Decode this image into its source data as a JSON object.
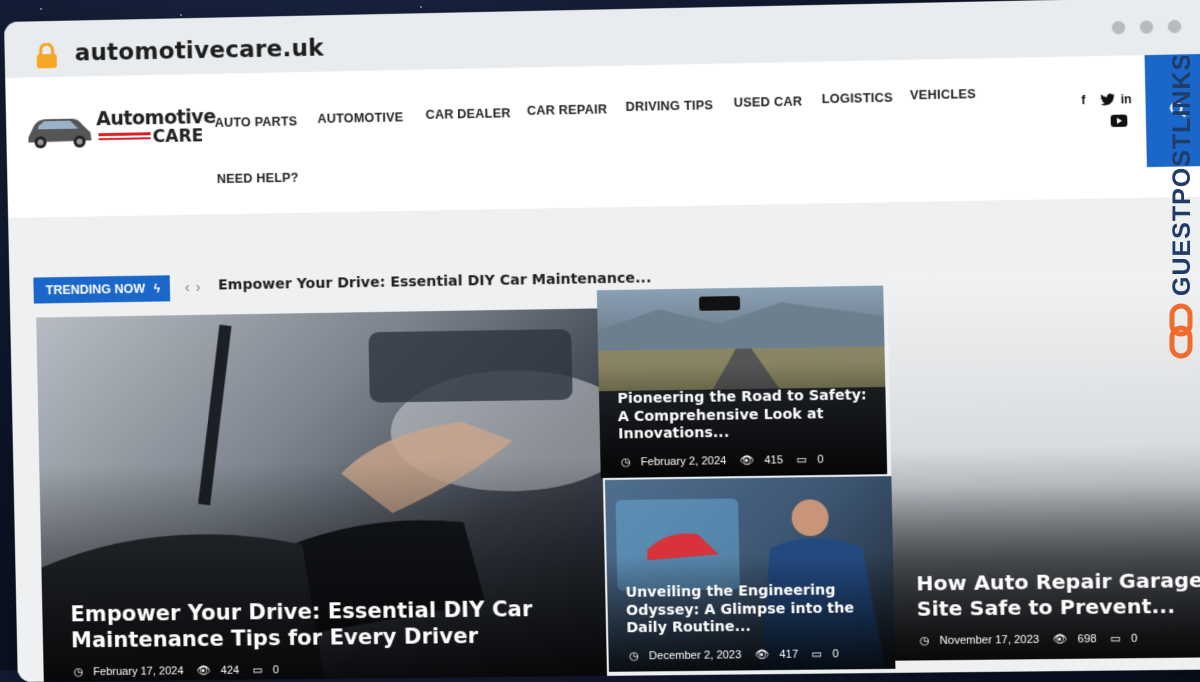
{
  "browser": {
    "url": "automotivecare.uk"
  },
  "logo": {
    "line1": "Automotive",
    "line2": "CARE"
  },
  "nav": {
    "items": [
      "AUTO PARTS",
      "AUTOMOTIVE",
      "CAR DEALER",
      "CAR REPAIR",
      "DRIVING TIPS",
      "USED CAR",
      "LOGISTICS",
      "VEHICLES",
      "NEED HELP?"
    ]
  },
  "social": {
    "facebook": "f",
    "twitter": "t",
    "linkedin": "in",
    "youtube": "yt"
  },
  "trending": {
    "label": "TRENDING NOW",
    "headline": "Empower Your Drive: Essential DIY Car Maintenance..."
  },
  "posts": [
    {
      "title": "Empower Your Drive: Essential DIY Car Maintenance Tips for Every Driver",
      "date": "February 17, 2024",
      "views": "424",
      "comments": "0"
    },
    {
      "title": "Pioneering the Road to Safety: A Comprehensive Look at Innovations...",
      "date": "February 2, 2024",
      "views": "415",
      "comments": "0"
    },
    {
      "title": "Unveiling the Engineering Odyssey: A Glimpse into the Daily Routine...",
      "date": "December 2, 2023",
      "views": "417",
      "comments": "0"
    },
    {
      "title": "How Auto Repair Garages C Site Safe to Prevent...",
      "date": "November 17, 2023",
      "views": "698",
      "comments": "0"
    }
  ],
  "watermark": {
    "text": "GUESTPOSTLINKS"
  },
  "colors": {
    "accent": "#1b67c9",
    "brand_red": "#d61f26",
    "watermark_orange": "#f26b2d"
  }
}
